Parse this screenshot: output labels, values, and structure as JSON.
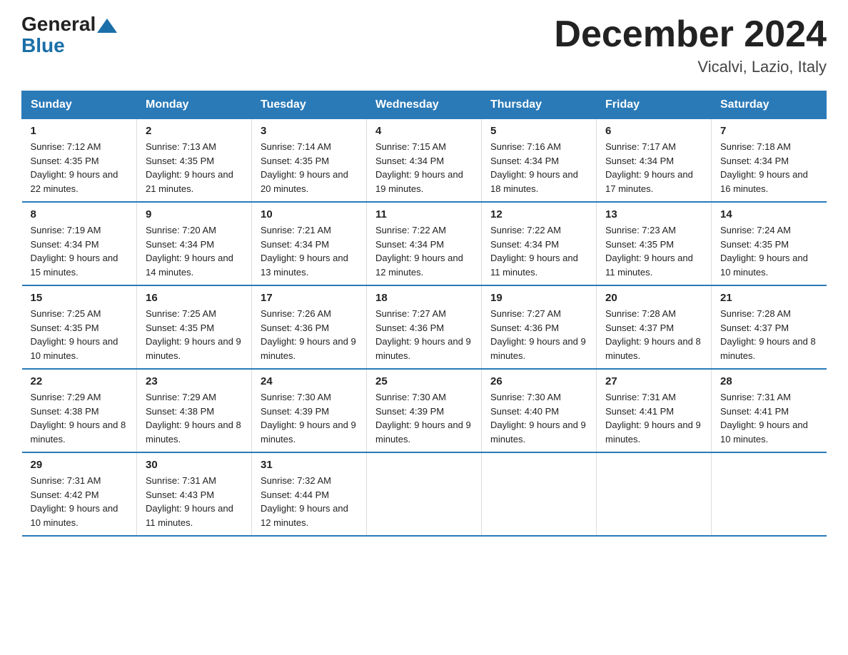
{
  "header": {
    "logo_general": "General",
    "logo_blue": "Blue",
    "month_title": "December 2024",
    "location": "Vicalvi, Lazio, Italy"
  },
  "days_of_week": [
    "Sunday",
    "Monday",
    "Tuesday",
    "Wednesday",
    "Thursday",
    "Friday",
    "Saturday"
  ],
  "weeks": [
    [
      {
        "day": "1",
        "sunrise": "7:12 AM",
        "sunset": "4:35 PM",
        "daylight": "9 hours and 22 minutes."
      },
      {
        "day": "2",
        "sunrise": "7:13 AM",
        "sunset": "4:35 PM",
        "daylight": "9 hours and 21 minutes."
      },
      {
        "day": "3",
        "sunrise": "7:14 AM",
        "sunset": "4:35 PM",
        "daylight": "9 hours and 20 minutes."
      },
      {
        "day": "4",
        "sunrise": "7:15 AM",
        "sunset": "4:34 PM",
        "daylight": "9 hours and 19 minutes."
      },
      {
        "day": "5",
        "sunrise": "7:16 AM",
        "sunset": "4:34 PM",
        "daylight": "9 hours and 18 minutes."
      },
      {
        "day": "6",
        "sunrise": "7:17 AM",
        "sunset": "4:34 PM",
        "daylight": "9 hours and 17 minutes."
      },
      {
        "day": "7",
        "sunrise": "7:18 AM",
        "sunset": "4:34 PM",
        "daylight": "9 hours and 16 minutes."
      }
    ],
    [
      {
        "day": "8",
        "sunrise": "7:19 AM",
        "sunset": "4:34 PM",
        "daylight": "9 hours and 15 minutes."
      },
      {
        "day": "9",
        "sunrise": "7:20 AM",
        "sunset": "4:34 PM",
        "daylight": "9 hours and 14 minutes."
      },
      {
        "day": "10",
        "sunrise": "7:21 AM",
        "sunset": "4:34 PM",
        "daylight": "9 hours and 13 minutes."
      },
      {
        "day": "11",
        "sunrise": "7:22 AM",
        "sunset": "4:34 PM",
        "daylight": "9 hours and 12 minutes."
      },
      {
        "day": "12",
        "sunrise": "7:22 AM",
        "sunset": "4:34 PM",
        "daylight": "9 hours and 11 minutes."
      },
      {
        "day": "13",
        "sunrise": "7:23 AM",
        "sunset": "4:35 PM",
        "daylight": "9 hours and 11 minutes."
      },
      {
        "day": "14",
        "sunrise": "7:24 AM",
        "sunset": "4:35 PM",
        "daylight": "9 hours and 10 minutes."
      }
    ],
    [
      {
        "day": "15",
        "sunrise": "7:25 AM",
        "sunset": "4:35 PM",
        "daylight": "9 hours and 10 minutes."
      },
      {
        "day": "16",
        "sunrise": "7:25 AM",
        "sunset": "4:35 PM",
        "daylight": "9 hours and 9 minutes."
      },
      {
        "day": "17",
        "sunrise": "7:26 AM",
        "sunset": "4:36 PM",
        "daylight": "9 hours and 9 minutes."
      },
      {
        "day": "18",
        "sunrise": "7:27 AM",
        "sunset": "4:36 PM",
        "daylight": "9 hours and 9 minutes."
      },
      {
        "day": "19",
        "sunrise": "7:27 AM",
        "sunset": "4:36 PM",
        "daylight": "9 hours and 9 minutes."
      },
      {
        "day": "20",
        "sunrise": "7:28 AM",
        "sunset": "4:37 PM",
        "daylight": "9 hours and 8 minutes."
      },
      {
        "day": "21",
        "sunrise": "7:28 AM",
        "sunset": "4:37 PM",
        "daylight": "9 hours and 8 minutes."
      }
    ],
    [
      {
        "day": "22",
        "sunrise": "7:29 AM",
        "sunset": "4:38 PM",
        "daylight": "9 hours and 8 minutes."
      },
      {
        "day": "23",
        "sunrise": "7:29 AM",
        "sunset": "4:38 PM",
        "daylight": "9 hours and 8 minutes."
      },
      {
        "day": "24",
        "sunrise": "7:30 AM",
        "sunset": "4:39 PM",
        "daylight": "9 hours and 9 minutes."
      },
      {
        "day": "25",
        "sunrise": "7:30 AM",
        "sunset": "4:39 PM",
        "daylight": "9 hours and 9 minutes."
      },
      {
        "day": "26",
        "sunrise": "7:30 AM",
        "sunset": "4:40 PM",
        "daylight": "9 hours and 9 minutes."
      },
      {
        "day": "27",
        "sunrise": "7:31 AM",
        "sunset": "4:41 PM",
        "daylight": "9 hours and 9 minutes."
      },
      {
        "day": "28",
        "sunrise": "7:31 AM",
        "sunset": "4:41 PM",
        "daylight": "9 hours and 10 minutes."
      }
    ],
    [
      {
        "day": "29",
        "sunrise": "7:31 AM",
        "sunset": "4:42 PM",
        "daylight": "9 hours and 10 minutes."
      },
      {
        "day": "30",
        "sunrise": "7:31 AM",
        "sunset": "4:43 PM",
        "daylight": "9 hours and 11 minutes."
      },
      {
        "day": "31",
        "sunrise": "7:32 AM",
        "sunset": "4:44 PM",
        "daylight": "9 hours and 12 minutes."
      },
      null,
      null,
      null,
      null
    ]
  ]
}
